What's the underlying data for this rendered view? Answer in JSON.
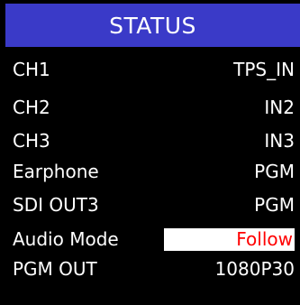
{
  "header": {
    "title": "STATUS"
  },
  "rows": [
    {
      "label": "CH1",
      "value": "TPS_IN"
    },
    {
      "label": "CH2",
      "value": "IN2"
    },
    {
      "label": "CH3",
      "value": "IN3"
    },
    {
      "label": "Earphone",
      "value": "PGM"
    },
    {
      "label": "SDI OUT3",
      "value": "PGM"
    },
    {
      "label": "Audio Mode",
      "value": "Follow",
      "selected": true
    },
    {
      "label": "PGM OUT",
      "value": "1080P30"
    }
  ],
  "colors": {
    "header_bg": "#3a3ac8",
    "background": "#000000",
    "text": "#ffffff",
    "selected_bg": "#ffffff",
    "selected_text": "#ff0000"
  }
}
